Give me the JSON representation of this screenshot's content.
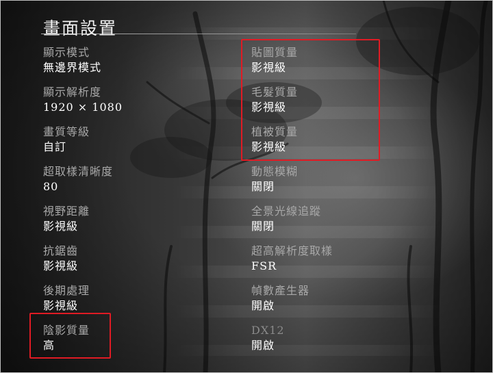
{
  "title": "畫面設置",
  "left_column": [
    {
      "label": "顯示模式",
      "value": "無邊界模式"
    },
    {
      "label": "顯示解析度",
      "value": "1920 × 1080"
    },
    {
      "label": "畫質等級",
      "value": "自訂"
    },
    {
      "label": "超取樣清晰度",
      "value": "80"
    },
    {
      "label": "視野距離",
      "value": "影視級"
    },
    {
      "label": "抗鋸齒",
      "value": "影視級"
    },
    {
      "label": "後期處理",
      "value": "影視級"
    },
    {
      "label": "陰影質量",
      "value": "高"
    }
  ],
  "right_column": [
    {
      "label": "貼圖質量",
      "value": "影視級"
    },
    {
      "label": "毛髮質量",
      "value": "影視級"
    },
    {
      "label": "植被質量",
      "value": "影視級"
    },
    {
      "label": "動態模糊",
      "value": "關閉"
    },
    {
      "label": "全景光線追蹤",
      "value": "關閉"
    },
    {
      "label": "超高解析度取樣",
      "value": "FSR"
    },
    {
      "label": "幀數產生器",
      "value": "開啟"
    },
    {
      "label": "DX12",
      "value": "開啟"
    }
  ],
  "highlight_color": "#e01b24"
}
